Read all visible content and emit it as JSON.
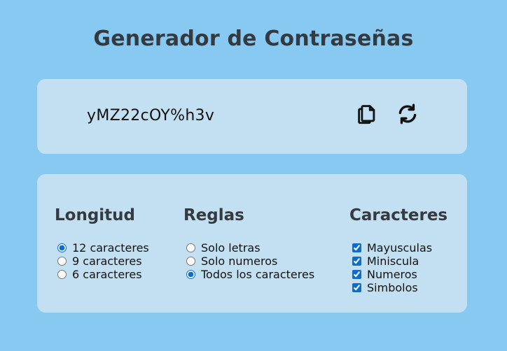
{
  "title": "Generador de Contraseñas",
  "password": {
    "value": "yMZ22cOY%h3v",
    "copy_icon": "copy-icon",
    "refresh_icon": "refresh-icon"
  },
  "longitud": {
    "heading": "Longitud",
    "options": [
      {
        "label": "12 caracteres",
        "checked": true
      },
      {
        "label": "9 caracteres",
        "checked": false
      },
      {
        "label": "6 caracteres",
        "checked": false
      }
    ]
  },
  "reglas": {
    "heading": "Reglas",
    "options": [
      {
        "label": "Solo letras",
        "checked": false
      },
      {
        "label": "Solo numeros",
        "checked": false
      },
      {
        "label": "Todos los caracteres",
        "checked": true
      }
    ]
  },
  "caracteres": {
    "heading": "Caracteres",
    "options": [
      {
        "label": "Mayusculas",
        "checked": true
      },
      {
        "label": "Miniscula",
        "checked": true
      },
      {
        "label": "Numeros",
        "checked": true
      },
      {
        "label": "Simbolos",
        "checked": true
      }
    ]
  },
  "colors": {
    "background": "#87c9f1",
    "card": "#c3e0f2",
    "heading": "#333a40",
    "radio_accent": "#0a6ed1"
  }
}
